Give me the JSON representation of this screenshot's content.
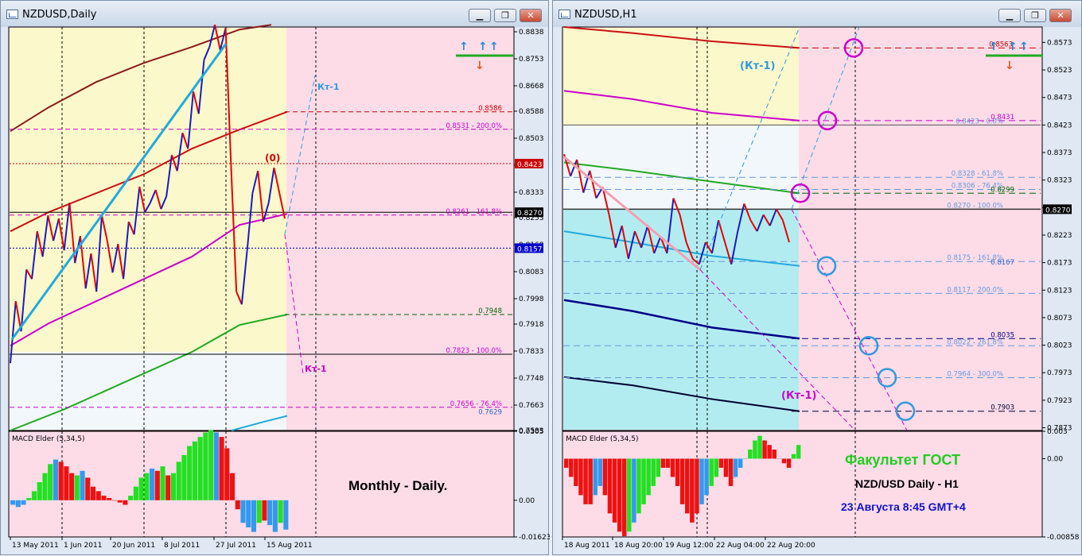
{
  "colors": {
    "yellow": "#fbf8cc",
    "pink": "#fddce8",
    "ice": "#f2f7fb",
    "cyan": "#b3ecf0",
    "bull": "#1b1bbd",
    "bear": "#e60000",
    "macd_up": "#22e022",
    "macd_dn": "#ee1111",
    "macd_neu": "#3399ee"
  },
  "windows": [
    {
      "title": "NZDUSD,Daily",
      "buttons": [
        "minimize-icon",
        "restore-icon",
        "close-icon"
      ]
    },
    {
      "title": "NZDUSD,H1",
      "buttons": [
        "minimize-icon",
        "restore-icon",
        "close-icon"
      ]
    }
  ],
  "chart_data": [
    {
      "type": "candlestick-line",
      "symbol": "NZDUSD",
      "timeframe": "Daily",
      "y_ticks": [
        "0.8838",
        "0.8753",
        "0.8668",
        "0.8588",
        "0.8503",
        "0.8418",
        "0.8333",
        "0.8253",
        "0.8168",
        "0.8083",
        "0.7998",
        "0.7918",
        "0.7833",
        "0.7748",
        "0.7663",
        "0.7583"
      ],
      "ylim": [
        0.7583,
        0.8853
      ],
      "x_ticks": [
        "13 May 2011",
        "1 Jun 2011",
        "20 Jun 2011",
        "8 Jul 2011",
        "27 Jul 2011",
        "15 Aug 2011"
      ],
      "price_path": [
        0.7795,
        0.799,
        0.7895,
        0.809,
        0.806,
        0.821,
        0.813,
        0.826,
        0.818,
        0.825,
        0.815,
        0.83,
        0.811,
        0.8195,
        0.803,
        0.814,
        0.802,
        0.826,
        0.818,
        0.808,
        0.817,
        0.806,
        0.824,
        0.82,
        0.835,
        0.827,
        0.83,
        0.834,
        0.828,
        0.832,
        0.845,
        0.84,
        0.852,
        0.847,
        0.865,
        0.858,
        0.875,
        0.879,
        0.886,
        0.878,
        0.885,
        0.842,
        0.802,
        0.798,
        0.815,
        0.833,
        0.84,
        0.824,
        0.83,
        0.841,
        0.833,
        0.825
      ],
      "price_labels": [
        {
          "text": "0.8586",
          "value": 0.8586,
          "color": "#cc0000"
        },
        {
          "text": "0.8531 - 200.0%",
          "value": 0.8531,
          "color": "#cc00cc"
        },
        {
          "text": "0.8423",
          "value": 0.8423,
          "color": "#cc0000",
          "box": true
        },
        {
          "text": "0.8270",
          "value": 0.827,
          "color": "#000000",
          "box": true
        },
        {
          "text": "0.8261 - 161.8%",
          "value": 0.8261,
          "color": "#cc00cc"
        },
        {
          "text": "0.8157",
          "value": 0.8157,
          "color": "#0000cc",
          "box": true
        },
        {
          "text": "0.7948",
          "value": 0.7948,
          "color": "#006600"
        },
        {
          "text": "0.7823 - 100.0%",
          "value": 0.7823,
          "color": "#cc00cc"
        },
        {
          "text": "0.7656 - 76.4%",
          "value": 0.7656,
          "color": "#cc00cc"
        },
        {
          "text": "0.7629",
          "value": 0.7629,
          "color": "#3366cc"
        }
      ],
      "annotations": [
        {
          "text": "(0)",
          "color": "#cc0000"
        },
        {
          "text": "Кт-1",
          "color": "#3399dd"
        },
        {
          "text": "Кт-1",
          "color": "#cc00cc"
        }
      ],
      "macd": {
        "label": "MACD Elder (5,34,5)",
        "y_ticks": [
          "0.0305",
          "0.00",
          "-0.01623"
        ],
        "ylim": [
          -0.01623,
          0.0305
        ],
        "values": [
          -0.002,
          -0.003,
          -0.002,
          0.001,
          0.004,
          0.008,
          0.012,
          0.016,
          0.018,
          0.017,
          0.015,
          0.012,
          0.011,
          0.013,
          0.01,
          0.006,
          0.004,
          0.002,
          0.001,
          0.0,
          -0.001,
          -0.002,
          0.002,
          0.006,
          0.01,
          0.012,
          0.014,
          0.013,
          0.015,
          0.011,
          0.012,
          0.017,
          0.02,
          0.024,
          0.026,
          0.028,
          0.03,
          0.031,
          0.03,
          0.028,
          0.023,
          0.012,
          -0.004,
          -0.01,
          -0.012,
          -0.014,
          -0.01,
          -0.009,
          -0.011,
          -0.014,
          -0.01,
          -0.013
        ],
        "colors": [
          "n",
          "n",
          "n",
          "u",
          "u",
          "u",
          "u",
          "u",
          "n",
          "d",
          "d",
          "d",
          "u",
          "n",
          "d",
          "d",
          "d",
          "d",
          "d",
          "d",
          "d",
          "d",
          "u",
          "u",
          "u",
          "u",
          "n",
          "d",
          "u",
          "d",
          "u",
          "u",
          "u",
          "u",
          "u",
          "u",
          "u",
          "u",
          "n",
          "d",
          "d",
          "d",
          "d",
          "n",
          "n",
          "n",
          "u",
          "d",
          "n",
          "n",
          "u",
          "n"
        ]
      },
      "overlay_text": "Monthly - Daily."
    },
    {
      "type": "candlestick-line",
      "symbol": "NZDUSD",
      "timeframe": "H1",
      "y_ticks": [
        "0.8573",
        "0.8523",
        "0.8473",
        "0.8423",
        "0.8373",
        "0.8323",
        "0.8273",
        "0.8223",
        "0.8173",
        "0.8123",
        "0.8073",
        "0.8023",
        "0.7973",
        "0.7923",
        "0.7873"
      ],
      "ylim": [
        0.7868,
        0.8601
      ],
      "x_ticks": [
        "18 Aug 2011",
        "18 Aug 20:00",
        "19 Aug 12:00",
        "22 Aug 04:00",
        "22 Aug 20:00"
      ],
      "price_path": [
        0.837,
        0.833,
        0.836,
        0.83,
        0.834,
        0.829,
        0.831,
        0.826,
        0.82,
        0.824,
        0.818,
        0.823,
        0.82,
        0.824,
        0.819,
        0.822,
        0.819,
        0.829,
        0.826,
        0.821,
        0.818,
        0.817,
        0.821,
        0.819,
        0.825,
        0.821,
        0.817,
        0.823,
        0.828,
        0.825,
        0.823,
        0.826,
        0.824,
        0.827,
        0.825,
        0.821
      ],
      "price_labels": [
        {
          "text": "0.8563",
          "value": 0.8563,
          "color": "#cc0000"
        },
        {
          "text": "0.8431",
          "value": 0.8431,
          "color": "#cc00cc"
        },
        {
          "text": "0.8423 - 0.0%",
          "value": 0.8423,
          "color": "#6699dd"
        },
        {
          "text": "0.8328 - 61.8%",
          "value": 0.8328,
          "color": "#6699dd"
        },
        {
          "text": "0.8306 - 76.4%",
          "value": 0.8306,
          "color": "#6699dd"
        },
        {
          "text": "0.8299",
          "value": 0.8299,
          "color": "#006600"
        },
        {
          "text": "0.8270",
          "value": 0.827,
          "color": "#000000",
          "box": true
        },
        {
          "text": "0.8270 - 100.0%",
          "value": 0.827,
          "color": "#6699dd"
        },
        {
          "text": "0.8175 - 161.8%",
          "value": 0.8175,
          "color": "#6699dd"
        },
        {
          "text": "0.8167",
          "value": 0.8167,
          "color": "#3366cc"
        },
        {
          "text": "0.8117 - 200.0%",
          "value": 0.8117,
          "color": "#6699dd"
        },
        {
          "text": "0.8035",
          "value": 0.8035,
          "color": "#000088"
        },
        {
          "text": "0.8022 - 261.8%",
          "value": 0.8022,
          "color": "#6699dd"
        },
        {
          "text": "0.7964 - 300.0%",
          "value": 0.7964,
          "color": "#6699dd"
        },
        {
          "text": "0.7903",
          "value": 0.7903,
          "color": "#000033"
        }
      ],
      "annotations": [
        {
          "text": "(Кт-1)",
          "color": "#3399dd"
        },
        {
          "text": "(Кт-1)",
          "color": "#cc00cc"
        }
      ],
      "macd": {
        "label": "MACD Elder (5,34,5)",
        "y_ticks": [
          "0.003",
          "0.00",
          "-0.00858"
        ],
        "ylim": [
          -0.00858,
          0.003
        ],
        "values": [
          -0.001,
          -0.002,
          -0.003,
          -0.004,
          -0.005,
          -0.005,
          -0.004,
          -0.003,
          -0.004,
          -0.006,
          -0.007,
          -0.008,
          -0.0085,
          -0.008,
          -0.007,
          -0.006,
          -0.005,
          -0.004,
          -0.003,
          -0.002,
          -0.001,
          -0.001,
          -0.002,
          -0.003,
          -0.005,
          -0.006,
          -0.007,
          -0.006,
          -0.005,
          -0.004,
          -0.003,
          -0.002,
          -0.001,
          -0.002,
          -0.003,
          -0.002,
          -0.001,
          0.0,
          0.001,
          0.002,
          0.0025,
          0.002,
          0.0015,
          0.001,
          0.0,
          -0.0005,
          -0.001,
          0.0005,
          0.0015
        ],
        "colors": [
          "d",
          "d",
          "d",
          "d",
          "d",
          "d",
          "n",
          "n",
          "d",
          "d",
          "d",
          "d",
          "d",
          "u",
          "n",
          "u",
          "u",
          "u",
          "u",
          "u",
          "d",
          "d",
          "d",
          "d",
          "d",
          "d",
          "d",
          "d",
          "n",
          "n",
          "u",
          "u",
          "d",
          "d",
          "d",
          "n",
          "n",
          "u",
          "u",
          "u",
          "u",
          "d",
          "d",
          "d",
          "n",
          "d",
          "d",
          "u",
          "u"
        ]
      },
      "overlay_texts": [
        {
          "text": "Факультет ГОСТ",
          "color": "#22cc22"
        },
        {
          "text": "NZD/USD Daily - H1",
          "color": "#000000"
        },
        {
          "text": "23 Августа 8:45 GMT+4",
          "color": "#1111cc"
        }
      ]
    }
  ]
}
